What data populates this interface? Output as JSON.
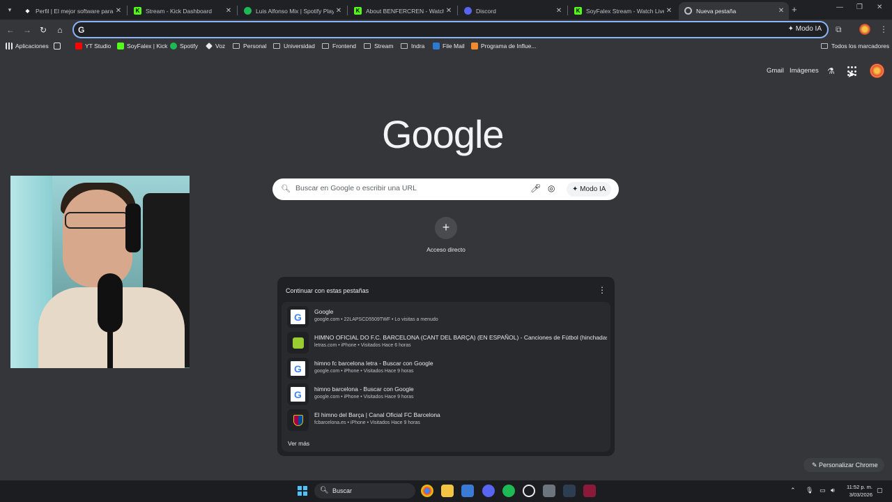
{
  "tabs": [
    {
      "title": "Perfil | El mejor software para p",
      "icon": "profile-favicon-icon"
    },
    {
      "title": "Stream - Kick Dashboard",
      "icon": "kick-icon"
    },
    {
      "title": "Luis Alfonso Mix | Spotify Playli",
      "icon": "spotify-icon"
    },
    {
      "title": "About BENFERCREN - Watch Li",
      "icon": "kick-icon"
    },
    {
      "title": "Discord",
      "icon": "discord-icon"
    },
    {
      "title": "SoyFalex Stream - Watch Live o",
      "icon": "kick-icon"
    },
    {
      "title": "Nueva pestaña",
      "icon": "chrome-icon"
    }
  ],
  "toolbar": {
    "omnibox_g": "G",
    "modo_ia": "Modo IA"
  },
  "bookmarks": {
    "items": [
      "Aplicaciones",
      "YT Studio",
      "SoyFalex | Kick",
      "Spotify",
      "Voz",
      "Personal",
      "Universidad",
      "Frontend",
      "Stream",
      "Indra",
      "File Mail",
      "Programa de Influe..."
    ],
    "all": "Todos los marcadores"
  },
  "ntp": {
    "gmail": "Gmail",
    "images": "Imágenes",
    "logo": "Google",
    "search_placeholder": "Buscar en Google o escribir una URL",
    "modo_ia": "Modo IA",
    "shortcut_label": "Acceso directo",
    "customize": "Personalizar Chrome"
  },
  "continue": {
    "title": "Continuar con estas pestañas",
    "more": "Ver más",
    "items": [
      {
        "title": "Google",
        "sub": "google.com • 22LAPSCD5509TWF • Lo visitas a menudo"
      },
      {
        "title": "HIMNO OFICIAL DO F.C. BARCELONA (CANT DEL BARÇA) (EN ESPAÑOL) - Canciones de Fútbol (hinchadas) -...",
        "sub": "letras.com • iPhone • Visitados Hace 6 horas"
      },
      {
        "title": "himno fc barcelona letra - Buscar con Google",
        "sub": "google.com • iPhone • Visitados Hace 9 horas"
      },
      {
        "title": "himno barcelona - Buscar con Google",
        "sub": "google.com • iPhone • Visitados Hace 9 horas"
      },
      {
        "title": "El himno del Barça | Canal Oficial FC Barcelona",
        "sub": "fcbarcelona.es • iPhone • Visitados Hace 9 horas"
      }
    ]
  },
  "taskbar": {
    "search": "Buscar",
    "time": "11:52 p. m.",
    "date": "3/03/2026"
  }
}
